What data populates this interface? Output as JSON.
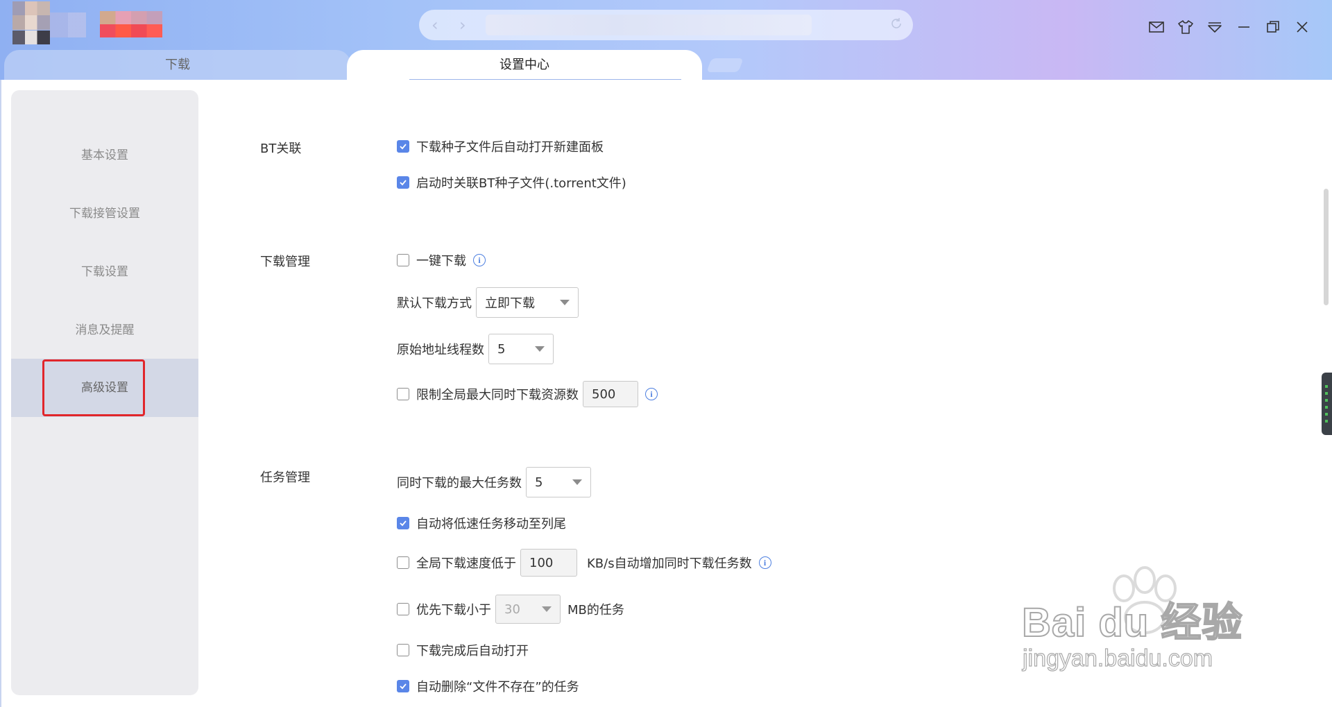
{
  "tabs": {
    "download": "下载",
    "settings": "设置中心"
  },
  "sidebar": {
    "items": [
      {
        "label": "基本设置",
        "active": false
      },
      {
        "label": "下载接管设置",
        "active": false
      },
      {
        "label": "下载设置",
        "active": false
      },
      {
        "label": "消息及提醒",
        "active": false
      },
      {
        "label": "高级设置",
        "active": true
      }
    ]
  },
  "sections": {
    "bt": {
      "title": "BT关联",
      "open_panel_label": "下载种子文件后自动打开新建面板",
      "open_panel_checked": true,
      "associate_label": "启动时关联BT种子文件(.torrent文件)",
      "associate_checked": true
    },
    "download_mgmt": {
      "title": "下载管理",
      "one_click_label": "一键下载",
      "one_click_checked": false,
      "default_mode_label": "默认下载方式",
      "default_mode_value": "立即下载",
      "threads_label": "原始地址线程数",
      "threads_value": "5",
      "limit_label": "限制全局最大同时下载资源数",
      "limit_checked": false,
      "limit_value": "500"
    },
    "task_mgmt": {
      "title": "任务管理",
      "max_tasks_label": "同时下载的最大任务数",
      "max_tasks_value": "5",
      "move_slow_label": "自动将低速任务移动至列尾",
      "move_slow_checked": true,
      "speed_low_label": "全局下载速度低于",
      "speed_low_checked": false,
      "speed_low_value": "100",
      "speed_low_suffix": "KB/s自动增加同时下载任务数",
      "prefer_small_label": "优先下载小于",
      "prefer_small_checked": false,
      "prefer_small_value": "30",
      "prefer_small_suffix": "MB的任务",
      "auto_open_label": "下载完成后自动打开",
      "auto_open_checked": false,
      "auto_delete_label": "自动删除“文件不存在”的任务",
      "auto_delete_checked": true
    }
  },
  "watermark": {
    "line1": "Bai du 经验",
    "line2": "jingyan.baidu.com"
  },
  "colors": {
    "accent": "#5a86e8",
    "highlight": "#e1262b",
    "info": "#4d7fe0"
  }
}
